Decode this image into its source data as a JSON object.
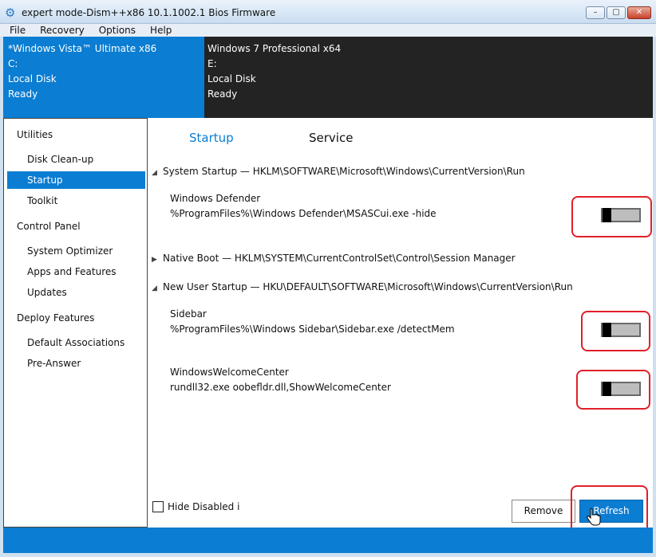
{
  "window": {
    "title": "expert mode-Dism++x86 10.1.1002.1 Bios Firmware",
    "minimize": "–",
    "maximize": "▢",
    "close": "✕"
  },
  "menu": [
    "File",
    "Recovery",
    "Options",
    "Help"
  ],
  "images": [
    {
      "name": "*Windows Vista™ Ultimate x86",
      "drive": "C:",
      "disk": "Local Disk",
      "status": "Ready"
    },
    {
      "name": "Windows 7 Professional x64",
      "drive": "E:",
      "disk": "Local Disk",
      "status": "Ready"
    }
  ],
  "sidebar": {
    "utilities": "Utilities",
    "disk_cleanup": "Disk Clean-up",
    "startup": "Startup",
    "toolkit": "Toolkit",
    "control_panel": "Control Panel",
    "system_optimizer": "System Optimizer",
    "apps_features": "Apps and Features",
    "updates": "Updates",
    "deploy_features": "Deploy Features",
    "default_associations": "Default Associations",
    "pre_answer": "Pre-Answer"
  },
  "tabs": {
    "startup": "Startup",
    "service": "Service"
  },
  "sections": {
    "system_startup": "System Startup — HKLM\\SOFTWARE\\Microsoft\\Windows\\CurrentVersion\\Run",
    "native_boot": "Native Boot — HKLM\\SYSTEM\\CurrentControlSet\\Control\\Session Manager",
    "new_user_startup": "New User Startup — HKU\\DEFAULT\\SOFTWARE\\Microsoft\\Windows\\CurrentVersion\\Run"
  },
  "entries": [
    {
      "name": "Windows Defender",
      "command": "%ProgramFiles%\\Windows Defender\\MSASCui.exe -hide",
      "enabled": false
    },
    {
      "name": "Sidebar",
      "command": "%ProgramFiles%\\Windows Sidebar\\Sidebar.exe /detectMem",
      "enabled": false
    },
    {
      "name": "WindowsWelcomeCenter",
      "command": "rundll32.exe oobefldr.dll,ShowWelcomeCenter",
      "enabled": false
    }
  ],
  "footer": {
    "hide_disabled": "Hide Disabled i",
    "remove": "Remove",
    "refresh": "Refresh"
  },
  "colors": {
    "accent": "#0b7dd2",
    "highlight_box": "#e0202a"
  }
}
